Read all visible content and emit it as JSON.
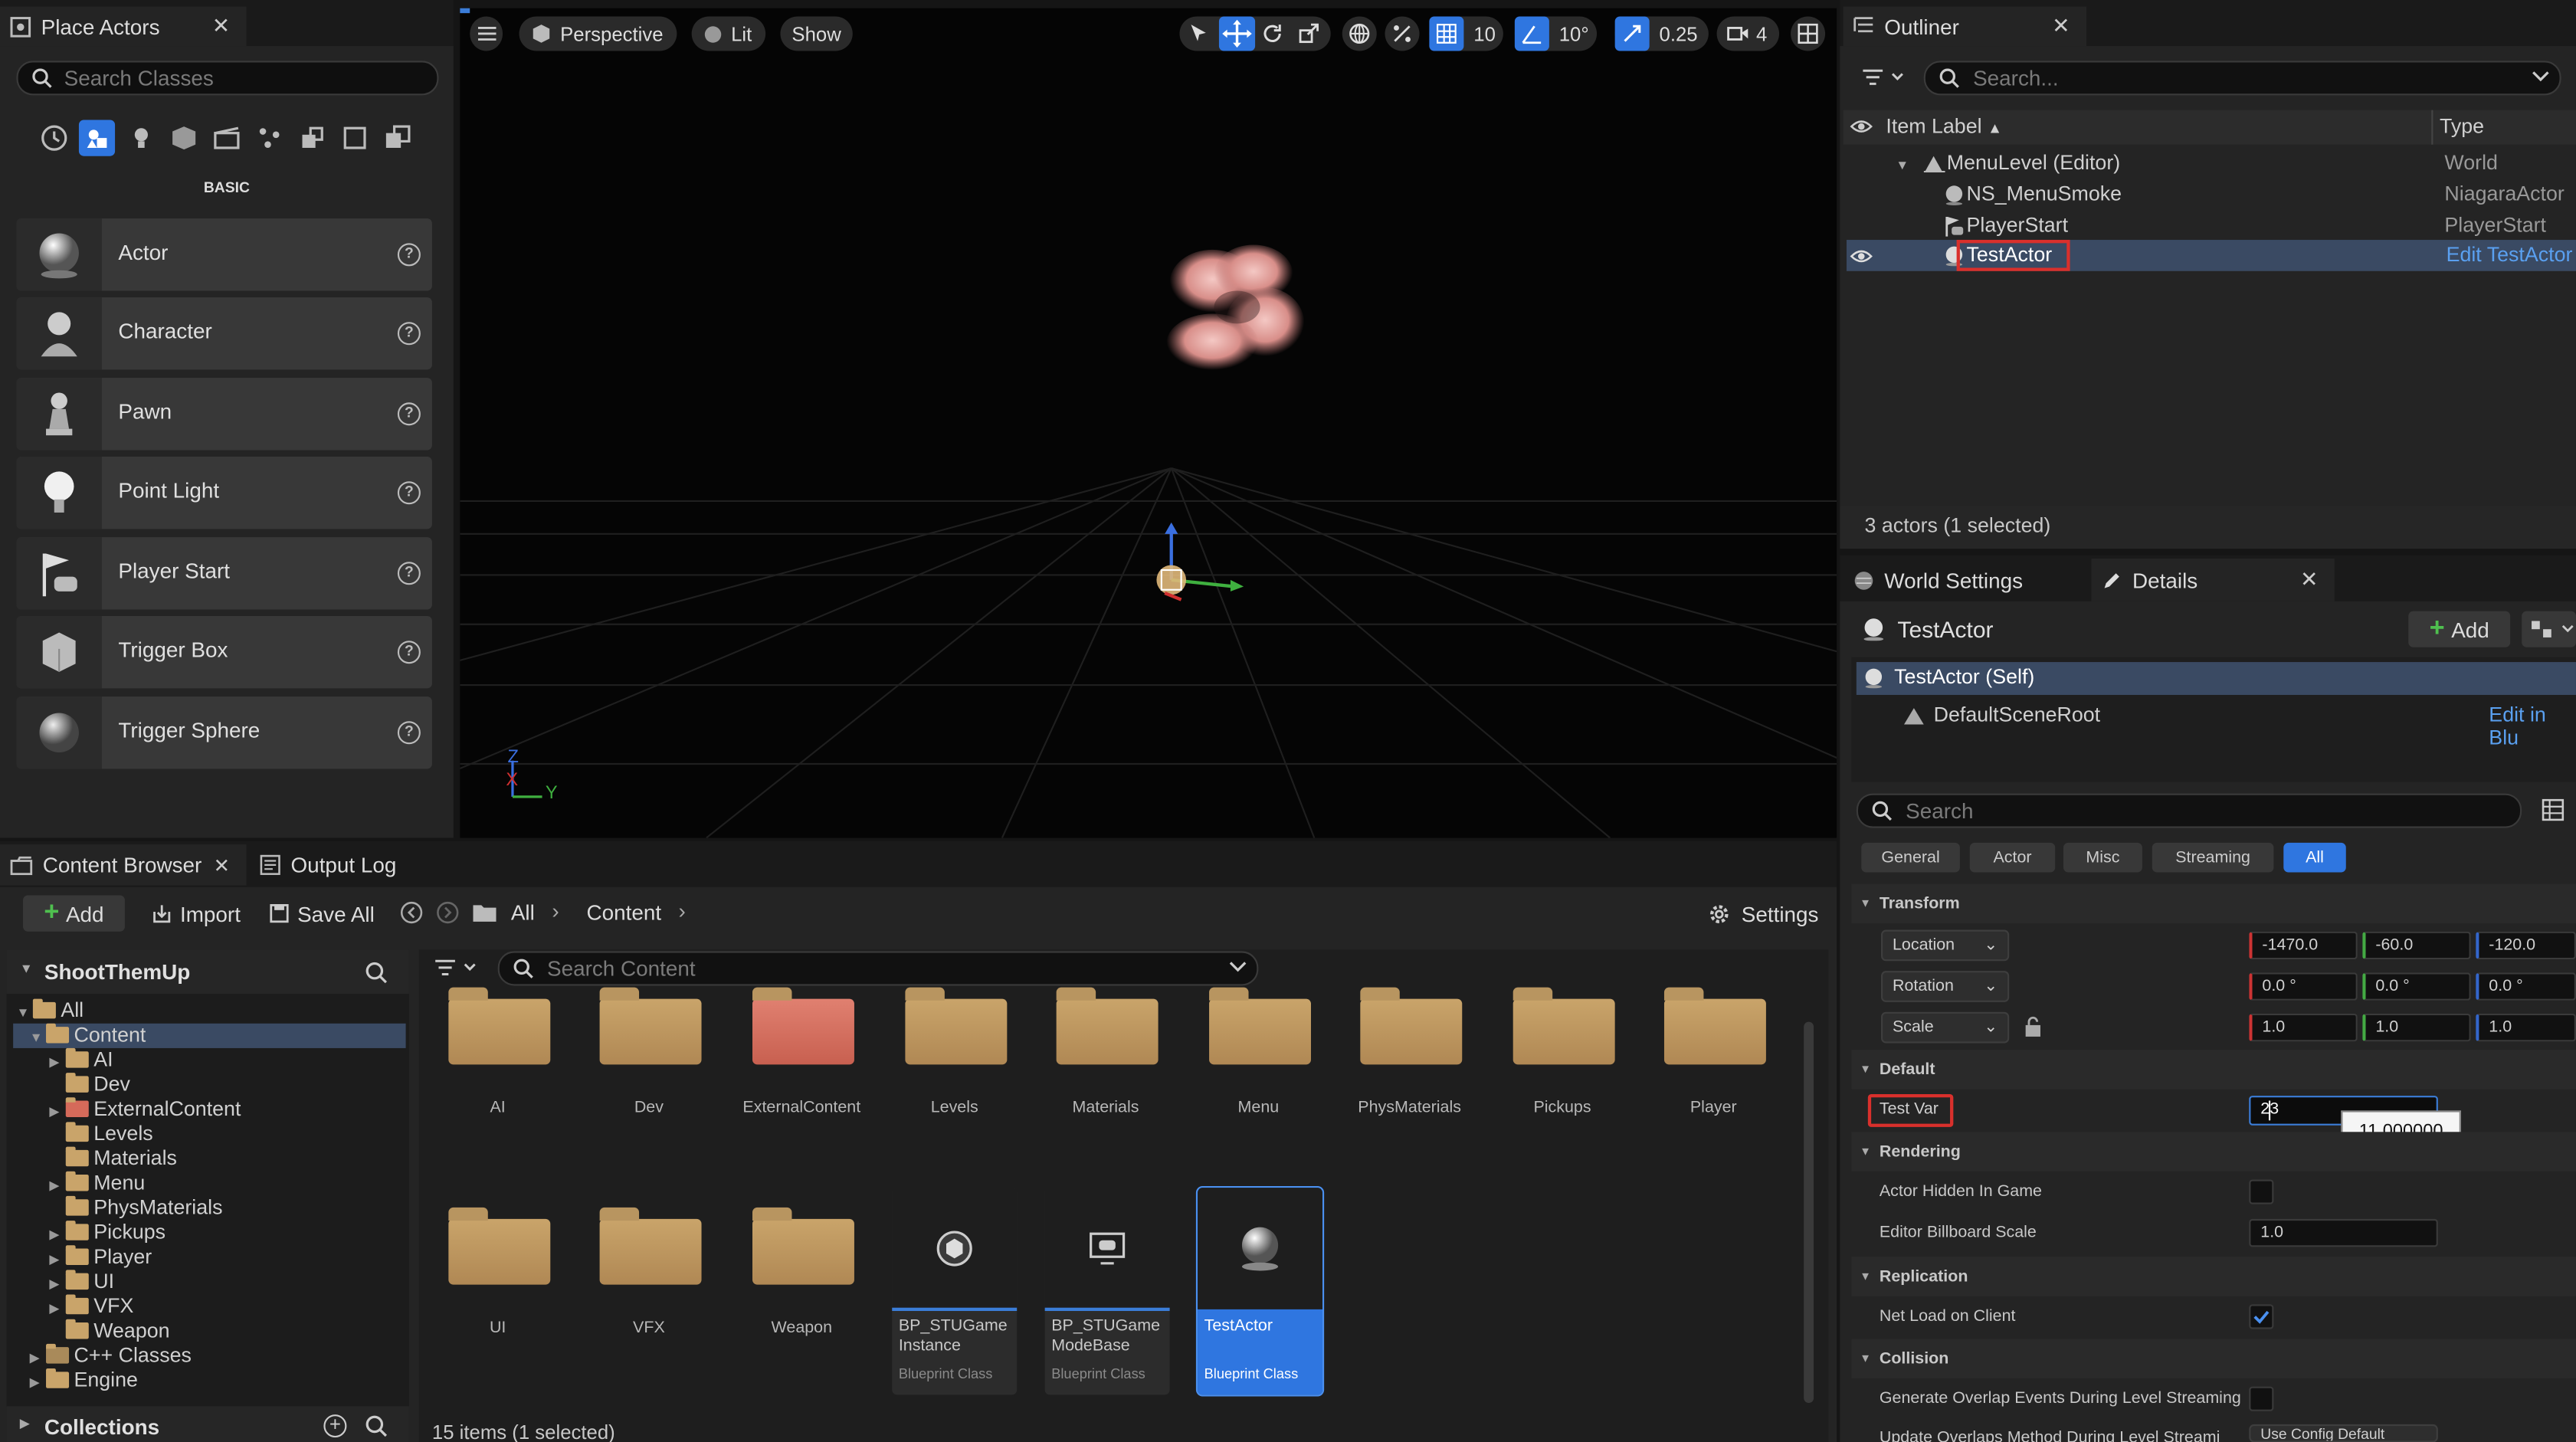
{
  "place_actors": {
    "tab_title": "Place Actors",
    "search_placeholder": "Search Classes",
    "category_heading": "BASIC",
    "items": [
      {
        "label": "Actor",
        "icon": "sphere-icon"
      },
      {
        "label": "Character",
        "icon": "character-icon"
      },
      {
        "label": "Pawn",
        "icon": "pawn-icon"
      },
      {
        "label": "Point Light",
        "icon": "point-light-icon"
      },
      {
        "label": "Player Start",
        "icon": "player-start-icon"
      },
      {
        "label": "Trigger Box",
        "icon": "trigger-box-icon"
      },
      {
        "label": "Trigger Sphere",
        "icon": "trigger-sphere-icon"
      }
    ]
  },
  "viewport": {
    "perspective_label": "Perspective",
    "lit_label": "Lit",
    "show_label": "Show",
    "grid_snap": "10",
    "rotation_snap": "10°",
    "scale_snap": "0.25",
    "camera_speed": "4",
    "axis_z": "Z",
    "axis_x": "X",
    "axis_y": "Y"
  },
  "content_browser": {
    "tab_title": "Content Browser",
    "output_log_tab": "Output Log",
    "add_label": "Add",
    "import_label": "Import",
    "save_all_label": "Save All",
    "breadcrumb": [
      "All",
      "Content"
    ],
    "settings_label": "Settings",
    "project_name": "ShootThemUp",
    "search_placeholder": "Search Content",
    "tree": [
      {
        "label": "All"
      },
      {
        "label": "Content"
      },
      {
        "label": "AI"
      },
      {
        "label": "Dev"
      },
      {
        "label": "ExternalContent"
      },
      {
        "label": "Levels"
      },
      {
        "label": "Materials"
      },
      {
        "label": "Menu"
      },
      {
        "label": "PhysMaterials"
      },
      {
        "label": "Pickups"
      },
      {
        "label": "Player"
      },
      {
        "label": "UI"
      },
      {
        "label": "VFX"
      },
      {
        "label": "Weapon"
      },
      {
        "label": "C++ Classes"
      },
      {
        "label": "Engine"
      }
    ],
    "collections_label": "Collections",
    "folders_row1": [
      "AI",
      "Dev",
      "ExternalContent",
      "Levels",
      "Materials",
      "Menu",
      "PhysMaterials",
      "Pickups",
      "Player"
    ],
    "folders_row2": [
      "UI",
      "VFX",
      "Weapon"
    ],
    "assets": [
      {
        "name_line1": "BP_STUGame",
        "name_line2": "Instance",
        "type": "Blueprint Class"
      },
      {
        "name_line1": "BP_STUGame",
        "name_line2": "ModeBase",
        "type": "Blueprint Class"
      },
      {
        "name_line1": "TestActor",
        "name_line2": "",
        "type": "Blueprint Class"
      }
    ],
    "status": "15 items (1 selected)"
  },
  "outliner": {
    "tab_title": "Outliner",
    "search_placeholder": "Search...",
    "col_label": "Item Label",
    "col_type": "Type",
    "rows": [
      {
        "label": "MenuLevel (Editor)",
        "type": "World"
      },
      {
        "label": "NS_MenuSmoke",
        "type": "NiagaraActor"
      },
      {
        "label": "PlayerStart",
        "type": "PlayerStart"
      },
      {
        "label": "TestActor",
        "type": "Edit TestActor"
      }
    ],
    "status": "3 actors (1 selected)"
  },
  "details": {
    "world_settings_tab": "World Settings",
    "details_tab": "Details",
    "actor_name": "TestActor",
    "add_label": "Add",
    "self_label": "TestActor (Self)",
    "root_label": "DefaultSceneRoot",
    "edit_in_bp": "Edit in Blu",
    "search_placeholder": "Search",
    "filters": [
      "General",
      "Actor",
      "Misc",
      "Streaming",
      "All"
    ],
    "transform_heading": "Transform",
    "location_label": "Location",
    "location": [
      "-1470.0",
      "-60.0",
      "-120.0"
    ],
    "rotation_label": "Rotation",
    "rotation": [
      "0.0 °",
      "0.0 °",
      "0.0 °"
    ],
    "scale_label": "Scale",
    "scale": [
      "1.0",
      "1.0",
      "1.0"
    ],
    "default_heading": "Default",
    "test_var_label": "Test Var",
    "test_var_value": "23",
    "test_var_tooltip": "11.000000",
    "rendering_heading": "Rendering",
    "hidden_label": "Actor Hidden In Game",
    "billboard_label": "Editor Billboard Scale",
    "billboard_value": "1.0",
    "replication_heading": "Replication",
    "net_load_label": "Net Load on Client",
    "collision_heading": "Collision",
    "overlap_label": "Generate Overlap Events During Level Streaming",
    "update_overlaps_label": "Update Overlaps Method During Level Streami",
    "update_overlaps_value": "Use Config Default"
  },
  "colors": {
    "accent": "#3b7dd8",
    "highlight_box": "#d9302c",
    "selected_row": "#3a4a63",
    "folder": "#c9a46a"
  }
}
